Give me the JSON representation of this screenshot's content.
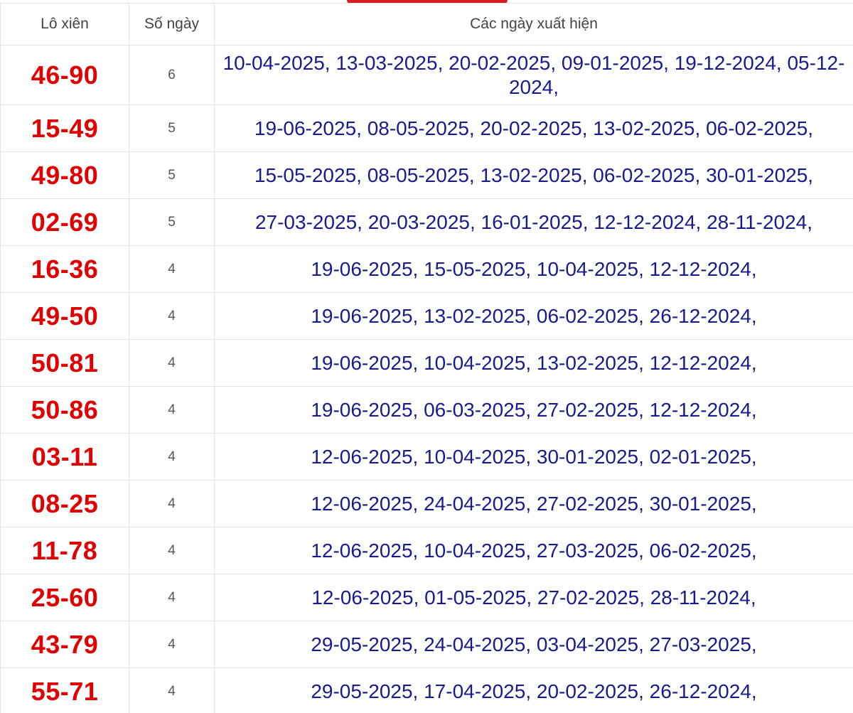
{
  "header": {
    "col_pair": "Lô xiên",
    "col_count": "Số ngày",
    "col_dates": "Các ngày xuất hiện"
  },
  "colors": {
    "pair": "#e00000",
    "dates": "#1a1a8c",
    "accent": "#d61f1f"
  },
  "rows": [
    {
      "pair": "46-90",
      "count": "6",
      "dates": "10-04-2025, 13-03-2025, 20-02-2025, 09-01-2025, 19-12-2024, 05-12-2024,"
    },
    {
      "pair": "15-49",
      "count": "5",
      "dates": "19-06-2025, 08-05-2025, 20-02-2025, 13-02-2025, 06-02-2025,"
    },
    {
      "pair": "49-80",
      "count": "5",
      "dates": "15-05-2025, 08-05-2025, 13-02-2025, 06-02-2025, 30-01-2025,"
    },
    {
      "pair": "02-69",
      "count": "5",
      "dates": "27-03-2025, 20-03-2025, 16-01-2025, 12-12-2024, 28-11-2024,"
    },
    {
      "pair": "16-36",
      "count": "4",
      "dates": "19-06-2025, 15-05-2025, 10-04-2025, 12-12-2024,"
    },
    {
      "pair": "49-50",
      "count": "4",
      "dates": "19-06-2025, 13-02-2025, 06-02-2025, 26-12-2024,"
    },
    {
      "pair": "50-81",
      "count": "4",
      "dates": "19-06-2025, 10-04-2025, 13-02-2025, 12-12-2024,"
    },
    {
      "pair": "50-86",
      "count": "4",
      "dates": "19-06-2025, 06-03-2025, 27-02-2025, 12-12-2024,"
    },
    {
      "pair": "03-11",
      "count": "4",
      "dates": "12-06-2025, 10-04-2025, 30-01-2025, 02-01-2025,"
    },
    {
      "pair": "08-25",
      "count": "4",
      "dates": "12-06-2025, 24-04-2025, 27-02-2025, 30-01-2025,"
    },
    {
      "pair": "11-78",
      "count": "4",
      "dates": "12-06-2025, 10-04-2025, 27-03-2025, 06-02-2025,"
    },
    {
      "pair": "25-60",
      "count": "4",
      "dates": "12-06-2025, 01-05-2025, 27-02-2025, 28-11-2024,"
    },
    {
      "pair": "43-79",
      "count": "4",
      "dates": "29-05-2025, 24-04-2025, 03-04-2025, 27-03-2025,"
    },
    {
      "pair": "55-71",
      "count": "4",
      "dates": "29-05-2025, 17-04-2025, 20-02-2025, 26-12-2024,"
    }
  ]
}
